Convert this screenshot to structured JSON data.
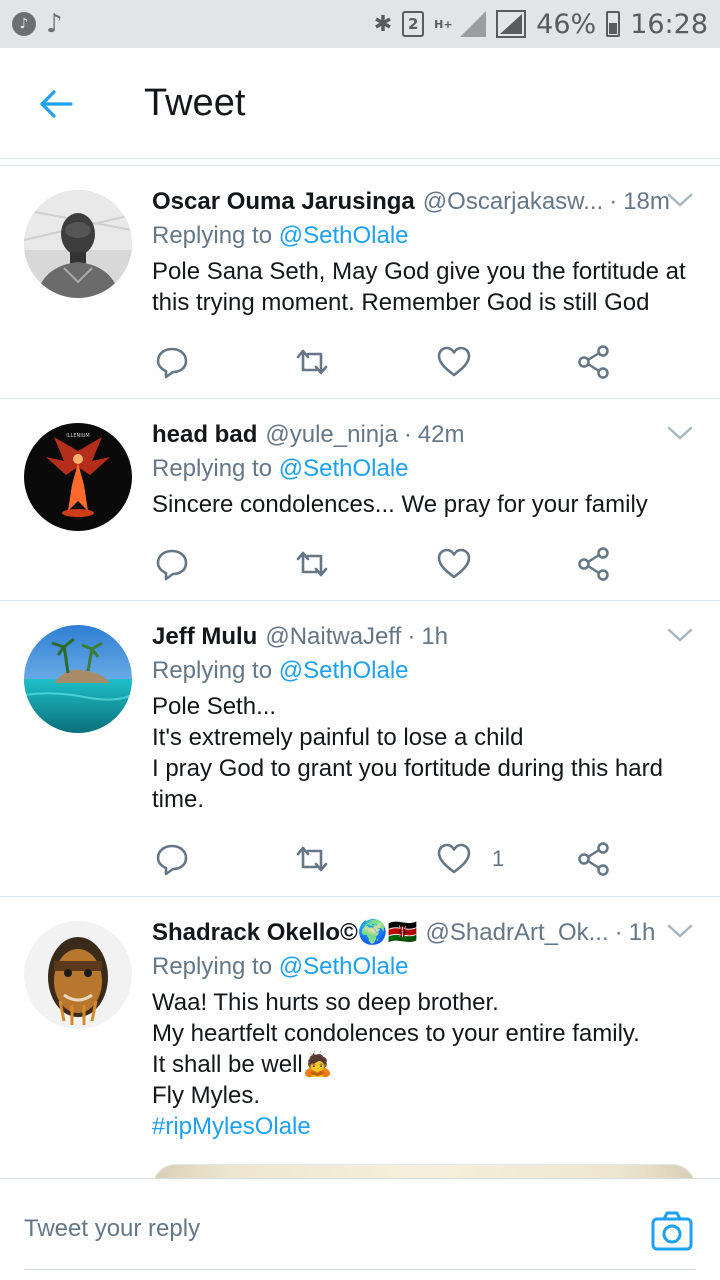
{
  "status_bar": {
    "battery": "46%",
    "time": "16:28",
    "sim": "2",
    "network": "H+",
    "icons": [
      "app-notification-icon",
      "music-note-icon",
      "bluetooth-icon",
      "sim-icon",
      "signal-icon",
      "battery-icon"
    ]
  },
  "header": {
    "title": "Tweet",
    "back_icon": "arrow-left-icon",
    "accent": "#1da1f2"
  },
  "tweets": [
    {
      "name": "Oscar  Ouma Jarusinga",
      "handle": "@Oscarjakasw...",
      "time": "18m",
      "reply_prefix": "Replying to",
      "mention": "@SethOlale",
      "body": "Pole Sana Seth,  May God give you the fortitude at this trying moment. Remember God is still God",
      "likes": "",
      "avatar": "grayscale-man-portrait"
    },
    {
      "name": "head bad",
      "handle": "@yule_ninja",
      "time": "42m",
      "reply_prefix": "Replying to",
      "mention": "@SethOlale",
      "body": "Sincere condolences... We pray for your family",
      "likes": "",
      "avatar": "flaming-angel-artwork"
    },
    {
      "name": "Jeff Mulu",
      "handle": "@NaitwaJeff",
      "time": "1h",
      "reply_prefix": "Replying to",
      "mention": "@SethOlale",
      "body": "Pole Seth...\nIt's extremely painful to lose a child\nI pray God to grant you fortitude during this hard time.",
      "likes": "1",
      "avatar": "tropical-beach"
    },
    {
      "name": "Shadrack Okello©🌍🇰🇪",
      "handle": "@ShadrArt_Ok...",
      "time": "1h",
      "reply_prefix": "Replying to",
      "mention": "@SethOlale",
      "body": "Waa! This hurts so deep brother.\nMy heartfelt condolences to your entire family.\nIt shall be well🙇",
      "body2": "Fly Myles.",
      "hashtag": "#ripMylesOlale",
      "likes": "",
      "avatar": "painted-face-portrait"
    }
  ],
  "reply_bar": {
    "placeholder": "Tweet your reply",
    "camera_icon": "camera-icon"
  }
}
